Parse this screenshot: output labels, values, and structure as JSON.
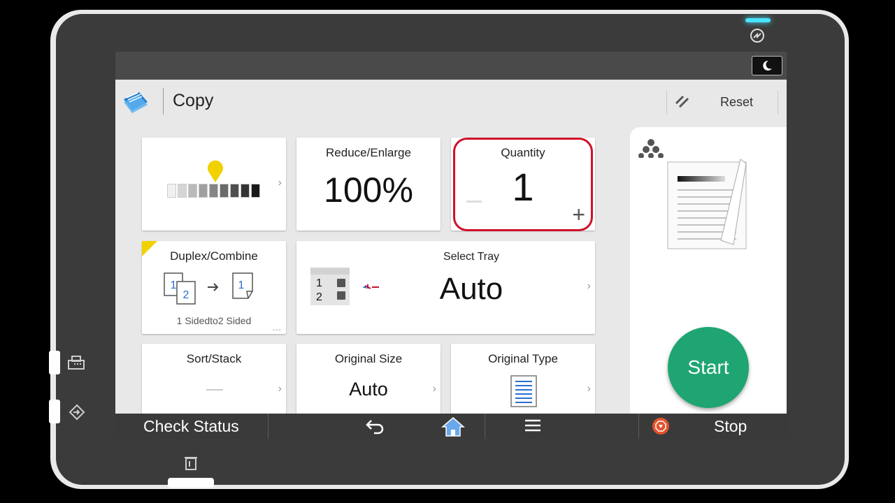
{
  "app": {
    "title": "Copy",
    "reset_label": "Reset"
  },
  "tiles": {
    "density": {
      "levels": 9,
      "selected": 5
    },
    "reduce_enlarge": {
      "label": "Reduce/Enlarge",
      "value": "100%"
    },
    "quantity": {
      "label": "Quantity",
      "value": "1"
    },
    "duplex": {
      "label": "Duplex/Combine",
      "sub": "1 Sidedto2 Sided",
      "more": "..."
    },
    "select_tray": {
      "label": "Select Tray",
      "value": "Auto",
      "tray1": "1",
      "tray2": "2"
    },
    "sort_stack": {
      "label": "Sort/Stack"
    },
    "original_size": {
      "label": "Original Size",
      "value": "Auto"
    },
    "original_type": {
      "label": "Original Type"
    }
  },
  "start_label": "Start",
  "navbar": {
    "check_status": "Check Status",
    "stop": "Stop"
  },
  "colors": {
    "accent_red": "#d0102a",
    "start_green": "#1fa572",
    "stop_orange": "#e2532d",
    "density_yellow": "#f2d100"
  }
}
